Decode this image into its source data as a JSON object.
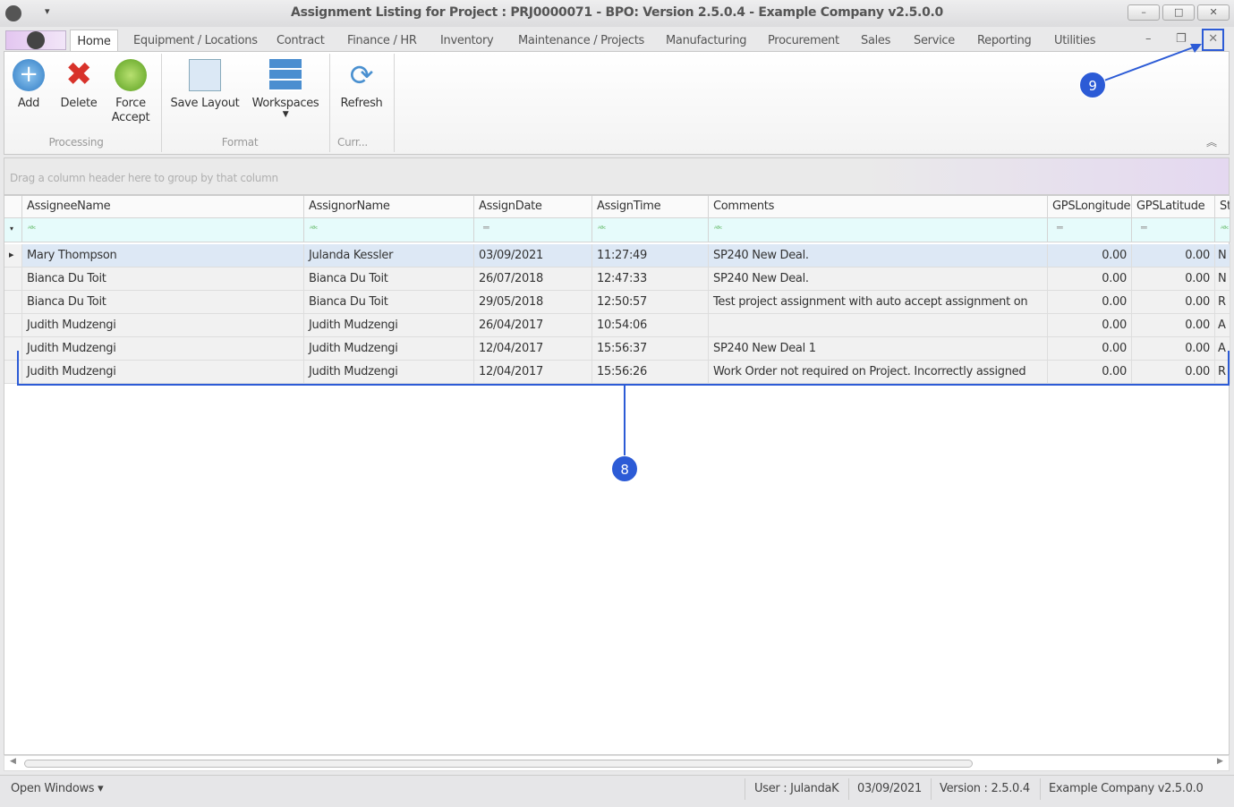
{
  "window": {
    "title": "Assignment Listing for Project : PRJ0000071 - BPO: Version 2.5.0.4 - Example Company v2.5.0.0",
    "minimize": "–",
    "maximize": "□",
    "close": "✕"
  },
  "tabs": [
    "Home",
    "Equipment / Locations",
    "Contract",
    "Finance / HR",
    "Inventory",
    "Maintenance / Projects",
    "Manufacturing",
    "Procurement",
    "Sales",
    "Service",
    "Reporting",
    "Utilities"
  ],
  "ribbon": {
    "add": "Add",
    "delete": "Delete",
    "force1": "Force",
    "force2": "Accept",
    "save_layout": "Save Layout",
    "workspaces": "Workspaces",
    "refresh": "Refresh",
    "group_processing": "Processing",
    "group_format": "Format",
    "group_curr": "Curr..."
  },
  "grid": {
    "group_hint": "Drag a column header here to group by that column",
    "columns": [
      "AssigneeName",
      "AssignorName",
      "AssignDate",
      "AssignTime",
      "Comments",
      "GPSLongitude",
      "GPSLatitude",
      "St"
    ],
    "filter_icons": [
      "abc",
      "abc",
      "=",
      "abc",
      "abc",
      "=",
      "=",
      "abc"
    ],
    "rows": [
      [
        "Mary Thompson",
        "Julanda Kessler",
        "03/09/2021",
        "11:27:49",
        "SP240 New Deal.",
        "0.00",
        "0.00",
        "N"
      ],
      [
        "Bianca Du Toit",
        "Bianca Du Toit",
        "26/07/2018",
        "12:47:33",
        "SP240 New Deal.",
        "0.00",
        "0.00",
        "N"
      ],
      [
        "Bianca Du Toit",
        "Bianca Du Toit",
        "29/05/2018",
        "12:50:57",
        "Test project assignment with auto accept assignment on",
        "0.00",
        "0.00",
        "R"
      ],
      [
        "Judith Mudzengi",
        "Judith Mudzengi",
        "26/04/2017",
        "10:54:06",
        "",
        "0.00",
        "0.00",
        "A"
      ],
      [
        "Judith Mudzengi",
        "Judith Mudzengi",
        "12/04/2017",
        "15:56:37",
        "SP240 New Deal 1",
        "0.00",
        "0.00",
        "A"
      ],
      [
        "Judith Mudzengi",
        "Judith Mudzengi",
        "12/04/2017",
        "15:56:26",
        "Work Order not required on Project.  Incorrectly assigned",
        "0.00",
        "0.00",
        "R"
      ]
    ]
  },
  "status": {
    "open_windows": "Open Windows ▾",
    "user": "User : JulandaK",
    "date": "03/09/2021",
    "version": "Version : 2.5.0.4",
    "company": "Example Company v2.5.0.0"
  },
  "annotations": {
    "a8": "8",
    "a9": "9",
    "color": "#2c5bd6"
  }
}
